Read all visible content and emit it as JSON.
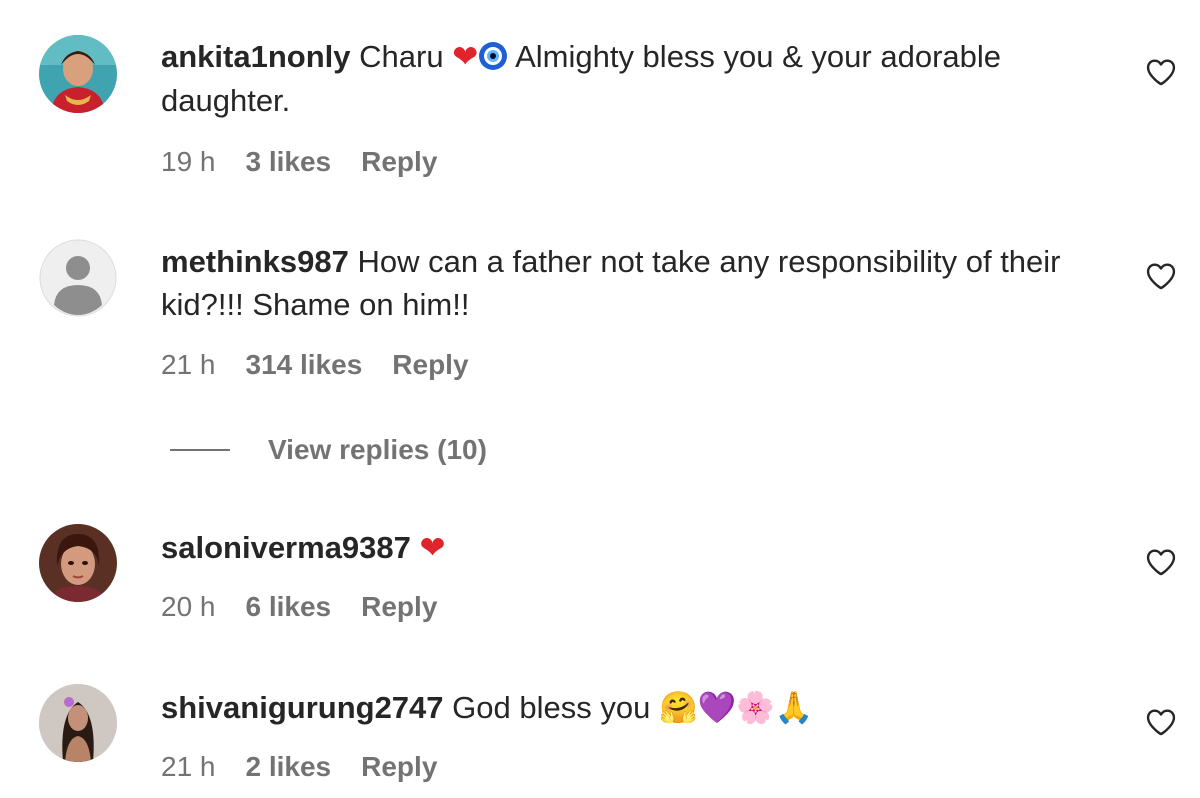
{
  "comments": [
    {
      "username": "ankita1nonly",
      "text": "Charu",
      "emoji_inline": "❤🧿",
      "text_after": "Almighty bless you & your adorable daughter.",
      "time": "19 h",
      "likes": "3 likes",
      "reply": "Reply",
      "avatar": "profile-photo"
    },
    {
      "username": "methinks987",
      "text": "How can a father not take any responsibility of their kid?!!! Shame on him!!",
      "time": "21 h",
      "likes": "314 likes",
      "reply": "Reply",
      "avatar": "default-avatar"
    },
    {
      "username": "saloniverma9387",
      "text": "",
      "emoji_inline": "❤",
      "time": "20 h",
      "likes": "6 likes",
      "reply": "Reply",
      "avatar": "profile-photo"
    },
    {
      "username": "shivanigurung2747",
      "text": "God bless you",
      "emoji_inline": "🤗💜🌸🙏",
      "time": "21 h",
      "likes": "2 likes",
      "reply": "Reply",
      "avatar": "profile-photo"
    }
  ],
  "view_replies": "View replies (10)",
  "icons": {
    "like": "heart-outline-icon"
  },
  "colors": {
    "text": "#262626",
    "secondary": "#737373",
    "background": "#ffffff"
  }
}
